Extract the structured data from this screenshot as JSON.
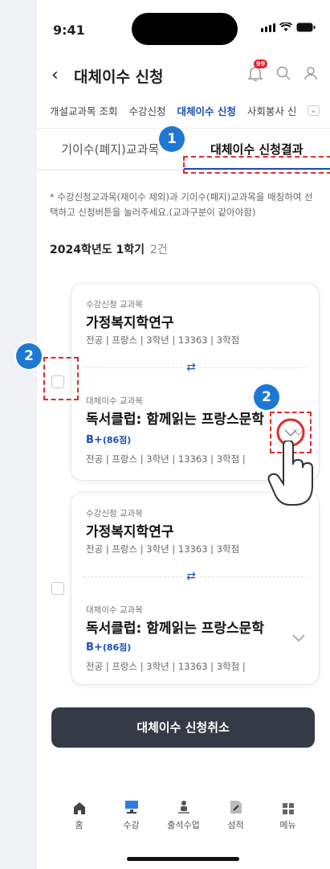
{
  "status": {
    "time": "9:41"
  },
  "header": {
    "back_icon": "chevron-left-icon",
    "title": "대체이수 신청",
    "notification_badge": "99"
  },
  "menu_tabs": [
    {
      "label": "개설교과목 조회",
      "active": false
    },
    {
      "label": "수강신청",
      "active": false
    },
    {
      "label": "대체이수 신청",
      "active": true
    },
    {
      "label": "사회봉사 신",
      "active": false
    }
  ],
  "sub_tabs": [
    {
      "label": "기이수(폐지)교과목",
      "active": false
    },
    {
      "label": "대체이수 신청결과",
      "active": true
    }
  ],
  "notice": "* 수강신청교과목(재이수 제외)과 기이수(폐지)교과목을 매칭하여 선택하고 신청버튼을 눌러주세요.(교과구분이 같아야함)",
  "semester": {
    "title": "2024학년도 1학기",
    "count": "2건"
  },
  "cards": [
    {
      "top_label": "수강신청 교과목",
      "top_name": "가정복지학연구",
      "top_meta": "전공 | 프랑스 | 3학년 | 13363 | 3학점",
      "bottom_label": "대체이수 교과목",
      "bottom_name": "독서클럽: 함께읽는 프랑스문학",
      "grade": "B+",
      "score": "(86점)",
      "bottom_meta": "전공 | 프랑스 | 3학년 | 13363 | 3학점 |"
    },
    {
      "top_label": "수강신청 교과목",
      "top_name": "가정복지학연구",
      "top_meta": "전공 | 프랑스 | 3학년 | 13363 | 3학점",
      "bottom_label": "대체이수 교과목",
      "bottom_name": "독서클럽: 함께읽는 프랑스문학",
      "grade": "B+",
      "score": "(86점)",
      "bottom_meta": "전공 | 프랑스 | 3학년 | 13363 | 3학점 |"
    }
  ],
  "cancel_button": "대체이수 신청취소",
  "bottom_nav": [
    {
      "label": "홈",
      "icon": "home-icon"
    },
    {
      "label": "수강",
      "icon": "class-icon"
    },
    {
      "label": "출석수업",
      "icon": "attendance-icon"
    },
    {
      "label": "성적",
      "icon": "grade-icon"
    },
    {
      "label": "메뉴",
      "icon": "menu-grid-icon"
    }
  ],
  "markers": [
    "1",
    "2",
    "2"
  ],
  "colors": {
    "accent": "#1a4fb5",
    "marker": "#1f77d4",
    "annotation": "#e12a2a",
    "button": "#363a47"
  }
}
